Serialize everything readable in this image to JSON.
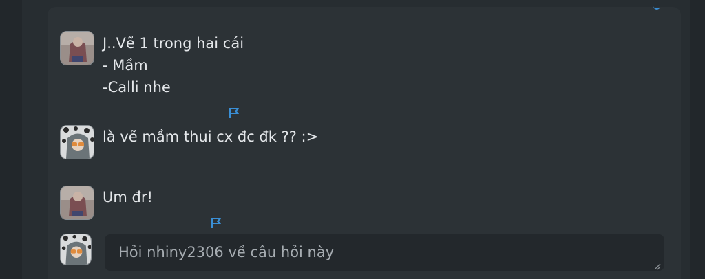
{
  "comments": [
    {
      "author_avatar": "avatar-user-1",
      "lines": [
        "J..Vẽ 1 trong hai cái",
        "- Mầm",
        "-Calli nhe"
      ],
      "flagged": true
    },
    {
      "author_avatar": "avatar-user-2",
      "lines": [
        "là vẽ mầm thui cx đc đk ?? :>"
      ],
      "flagged": false
    },
    {
      "author_avatar": "avatar-user-1",
      "lines": [
        "Um đr!"
      ],
      "flagged": true
    }
  ],
  "reply": {
    "placeholder": "Hỏi nhiny2306 về câu hỏi này",
    "avatar": "avatar-current-user"
  },
  "colors": {
    "background": "#252a2e",
    "card": "#2c3236",
    "text": "#e4e7ea",
    "flag": "#3a8fd6",
    "input_bg": "#23282c",
    "placeholder": "#a6acb1"
  },
  "icons": {
    "flag": "flag-icon",
    "resize": "resize-handle-icon"
  }
}
